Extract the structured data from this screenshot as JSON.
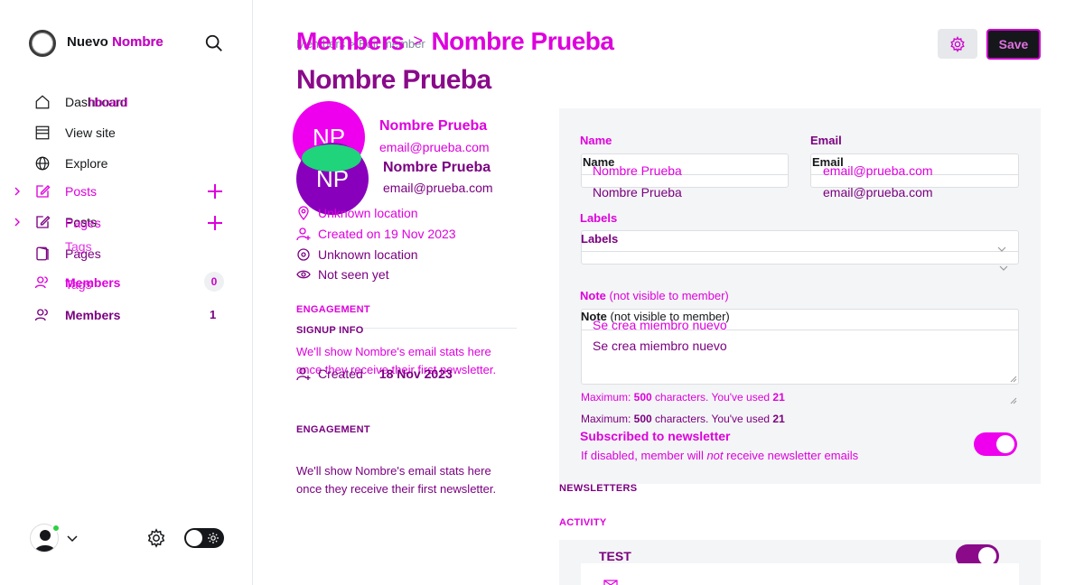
{
  "sidebar": {
    "site_name": "Nuevo Nombre",
    "site_name_overlay": "Nombre",
    "nav": [
      {
        "label": "Dashboard",
        "overlay": "hboard",
        "icon": "home-icon"
      },
      {
        "label": "View site",
        "icon": "browser-icon"
      },
      {
        "label": "Explore",
        "icon": "globe-icon"
      },
      {
        "label": "Posts",
        "icon": "edit-icon"
      },
      {
        "label": "Pages",
        "ghost": "Posts",
        "icon": "pages-icon"
      },
      {
        "label": "Pages",
        "ghost": "Tags",
        "icon": "tag-icon"
      },
      {
        "label": "Members",
        "ghost": "Tags",
        "count": "0",
        "icon": "members-icon"
      },
      {
        "label": "Members",
        "count": "1",
        "icon": "members-icon"
      }
    ]
  },
  "header": {
    "crumb_small": "Members  >  Edit member",
    "crumb_parent": "Members",
    "crumb_sep": ">",
    "crumb_current": "Nombre Prueba",
    "title": "Nombre Prueba",
    "save_label": "Save"
  },
  "member": {
    "initials": "NP",
    "name": "Nombre Prueba",
    "email": "email@prueba.com",
    "location": "Unknown location",
    "created": "Created on 19 Nov 2023",
    "last_seen": "Not seen yet",
    "created_signup_label": "Created",
    "created_signup_date": "18 Nov 2023"
  },
  "sections": {
    "engagement": "ENGAGEMENT",
    "signup_info": "SIGNUP INFO",
    "engagement_note": "We'll show Nombre's email stats here once they receive their first newsletter.",
    "newsletters": "NEWSLETTERS",
    "activity": "ACTIVITY"
  },
  "form": {
    "name_label": "Name",
    "name_value": "Nombre Prueba",
    "email_label": "Email",
    "email_value": "email@prueba.com",
    "labels_label": "Labels",
    "note_label": "Note",
    "note_suffix": "(not visible to member)",
    "note_value": "Se crea miembro nuevo",
    "max_prefix": "Maximum: ",
    "max_value": "500",
    "max_mid": " characters. You've used ",
    "used_value": "21",
    "newsletter_title": "Subscribed to newsletter",
    "newsletter_hint_a": "If disabled, member will ",
    "newsletter_hint_em": "not",
    "newsletter_hint_b": " receive newsletter emails",
    "newsletter_enabled": true
  },
  "newsletters": [
    {
      "name": "TEST",
      "enabled": true
    }
  ],
  "colors": {
    "magenta": "#dd00dd",
    "purple": "#7a0080",
    "toggle_on": "#ee00ee",
    "toggle_on_dark": "#8a0a8a",
    "online": "#30cf43"
  }
}
